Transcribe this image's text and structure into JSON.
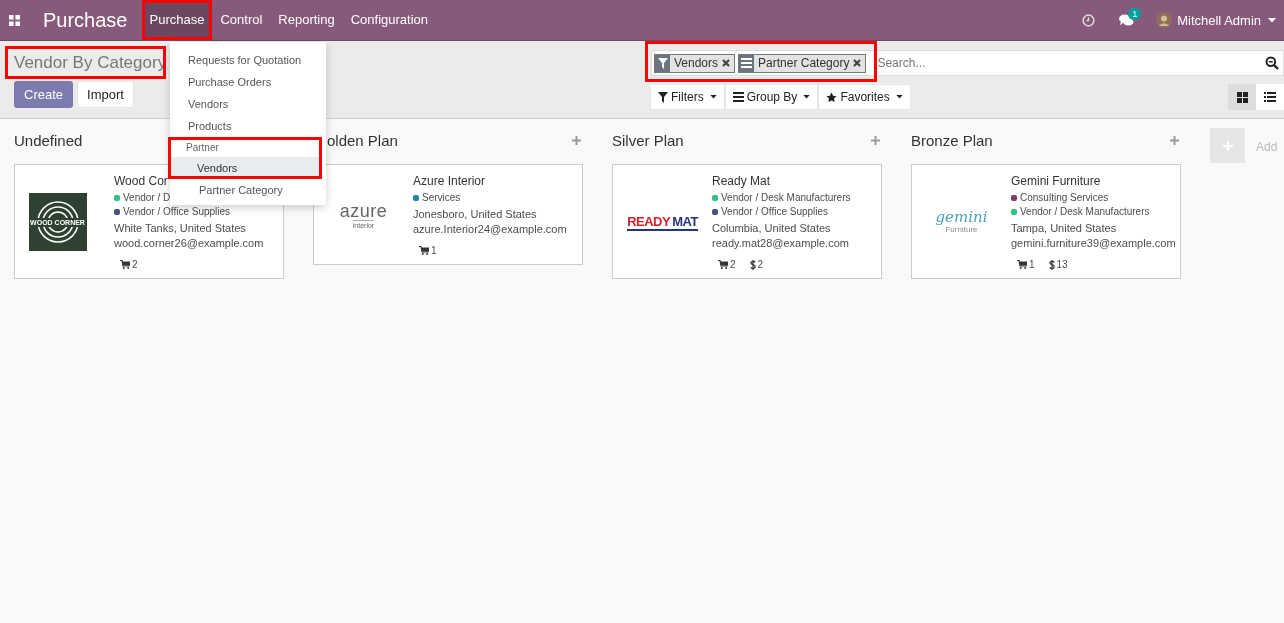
{
  "navbar": {
    "app_title": "Purchase",
    "menus": [
      {
        "label": "Purchase",
        "selected": true,
        "highlighted": true
      },
      {
        "label": "Control",
        "selected": false,
        "highlighted": false
      },
      {
        "label": "Reporting",
        "selected": false,
        "highlighted": false
      },
      {
        "label": "Configuration",
        "selected": false,
        "highlighted": false
      }
    ],
    "chat_badge": "1",
    "user": "Mitchell Admin"
  },
  "dropdown": {
    "items": [
      {
        "kind": "item",
        "label": "Requests for Quotation",
        "selected": false,
        "highlighted": false
      },
      {
        "kind": "item",
        "label": "Purchase Orders",
        "selected": false,
        "highlighted": false
      },
      {
        "kind": "item",
        "label": "Vendors",
        "selected": false,
        "highlighted": false
      },
      {
        "kind": "item",
        "label": "Products",
        "selected": false,
        "highlighted": false
      },
      {
        "kind": "header",
        "label": "Partner",
        "highlighted": true
      },
      {
        "kind": "subitem",
        "label": "Vendors",
        "selected": true,
        "highlighted": true
      },
      {
        "kind": "subitem",
        "label": "Partner Category",
        "selected": false,
        "highlighted": false
      }
    ]
  },
  "control_panel": {
    "title": "Vendor By Category",
    "title_highlighted": true,
    "create_button": "Create",
    "import_button": "Import",
    "search": {
      "facets_highlighted": true,
      "facets": [
        {
          "kind": "filter",
          "label": "Vendors"
        },
        {
          "kind": "groupby",
          "label": "Partner Category"
        }
      ],
      "placeholder": "Search..."
    },
    "filter_buttons": [
      {
        "kind": "filter",
        "label": "Filters"
      },
      {
        "kind": "groupby",
        "label": "Group By"
      },
      {
        "kind": "favorite",
        "label": "Favorites"
      }
    ],
    "views": [
      {
        "kind": "kanban",
        "selected": true
      },
      {
        "kind": "list",
        "selected": false
      }
    ]
  },
  "kanban": {
    "columns": [
      {
        "title": "Undefined",
        "show_add": false,
        "cards": [
          {
            "logo": {
              "kind": "wood",
              "lines": [
                "WOOD CORNER"
              ]
            },
            "name": "Wood Cor",
            "tags": [
              {
                "label": "Vendor / D",
                "color": "#30c381"
              },
              {
                "label": "Vendor / Office Supplies",
                "color": "#475577"
              }
            ],
            "location": "White Tanks, United States",
            "email": "wood.corner26@example.com",
            "counts": [
              {
                "kind": "cart",
                "value": "2"
              }
            ]
          }
        ]
      },
      {
        "title": "olden Plan",
        "show_add": true,
        "cards": [
          {
            "logo": {
              "kind": "azure",
              "lines": [
                "azure",
                "interior"
              ]
            },
            "name": "Azure Interior",
            "tags": [
              {
                "label": "Services",
                "color": "#2c8397"
              }
            ],
            "location": "Jonesboro, United States",
            "email": "azure.Interior24@example.com",
            "counts": [
              {
                "kind": "cart",
                "value": "1"
              }
            ]
          }
        ]
      },
      {
        "title": "Silver Plan",
        "show_add": true,
        "cards": [
          {
            "logo": {
              "kind": "readymat",
              "lines": [
                "READY",
                "MAT"
              ]
            },
            "name": "Ready Mat",
            "tags": [
              {
                "label": "Vendor / Desk Manufacturers",
                "color": "#30c381"
              },
              {
                "label": "Vendor / Office Supplies",
                "color": "#475577"
              }
            ],
            "location": "Columbia, United States",
            "email": "ready.mat28@example.com",
            "counts": [
              {
                "kind": "cart",
                "value": "2"
              },
              {
                "kind": "dollar",
                "value": "2"
              }
            ]
          }
        ]
      },
      {
        "title": "Bronze Plan",
        "show_add": true,
        "cards": [
          {
            "logo": {
              "kind": "gemini",
              "lines": [
                "gemini",
                "Furniture"
              ]
            },
            "name": "Gemini Furniture",
            "tags": [
              {
                "label": "Consulting Services",
                "color": "#7c3d6a"
              },
              {
                "label": "Vendor / Desk Manufacturers",
                "color": "#30c381"
              }
            ],
            "location": "Tampa, United States",
            "email": "gemini.furniture39@example.com",
            "counts": [
              {
                "kind": "cart",
                "value": "1"
              },
              {
                "kind": "dollar",
                "value": "13"
              }
            ]
          }
        ]
      }
    ],
    "add_column": "Add"
  }
}
